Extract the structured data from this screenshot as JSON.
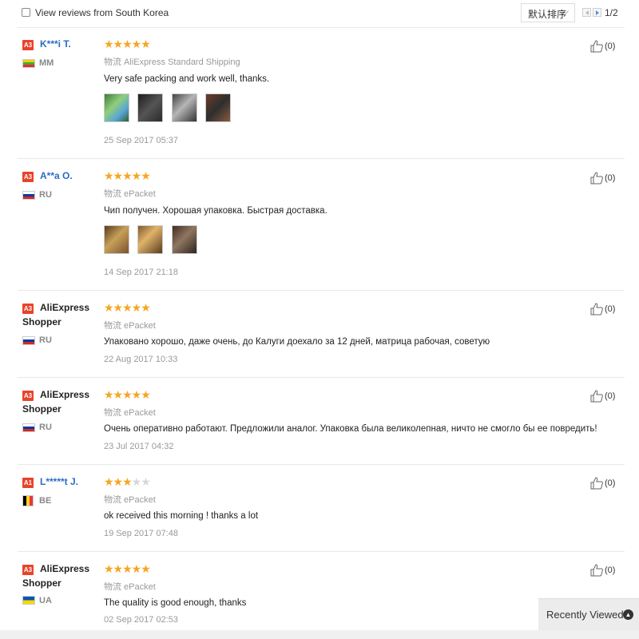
{
  "filter": {
    "label": "View reviews from South Korea"
  },
  "sort": {
    "label": "默认排序"
  },
  "pagination": {
    "text": "1/2"
  },
  "reviews": [
    {
      "level": "A3",
      "name": "K***i T.",
      "country": "MM",
      "rating": 5,
      "shipping": "物流 AliExpress Standard Shipping",
      "text": "Very safe packing and work well, thanks.",
      "date": "25 Sep 2017 05:37",
      "helpful": "(0)"
    },
    {
      "level": "A3",
      "name": "A**a O.",
      "country": "RU",
      "rating": 5,
      "shipping": "物流 ePacket",
      "text": "Чип получен. Хорошая упаковка. Быстрая доставка.",
      "date": "14 Sep 2017 21:18",
      "helpful": "(0)"
    },
    {
      "level": "A3",
      "name": "AliExpress",
      "name2": "Shopper",
      "country": "RU",
      "rating": 5,
      "shipping": "物流 ePacket",
      "text": "Упаковано хорошо, даже очень, до Калуги доехало за 12 дней, матрица рабочая, советую",
      "date": "22 Aug 2017 10:33",
      "helpful": "(0)"
    },
    {
      "level": "A3",
      "name": "AliExpress",
      "name2": "Shopper",
      "country": "RU",
      "rating": 5,
      "shipping": "物流 ePacket",
      "text": "Очень оперативно работают. Предложили аналог. Упаковка была великолепная, ничто не смогло бы ее повредить!",
      "date": "23 Jul 2017 04:32",
      "helpful": "(0)"
    },
    {
      "level": "A1",
      "name": "L*****t J.",
      "country": "BE",
      "rating": 3,
      "shipping": "物流 ePacket",
      "text": "ok received this morning ! thanks a lot",
      "date": "19 Sep 2017 07:48",
      "helpful": "(0)"
    },
    {
      "level": "A3",
      "name": "AliExpress",
      "name2": "Shopper",
      "country": "UA",
      "rating": 5,
      "shipping": "物流 ePacket",
      "text": "The quality is good enough, thanks",
      "date": "02 Sep 2017 02:53",
      "helpful": "(0)"
    }
  ],
  "recently_viewed": {
    "label": "Recently Viewed"
  },
  "colors": {
    "accent": "#2b6cc7",
    "star": "#f5a623",
    "level_badge": "#e8432b"
  }
}
